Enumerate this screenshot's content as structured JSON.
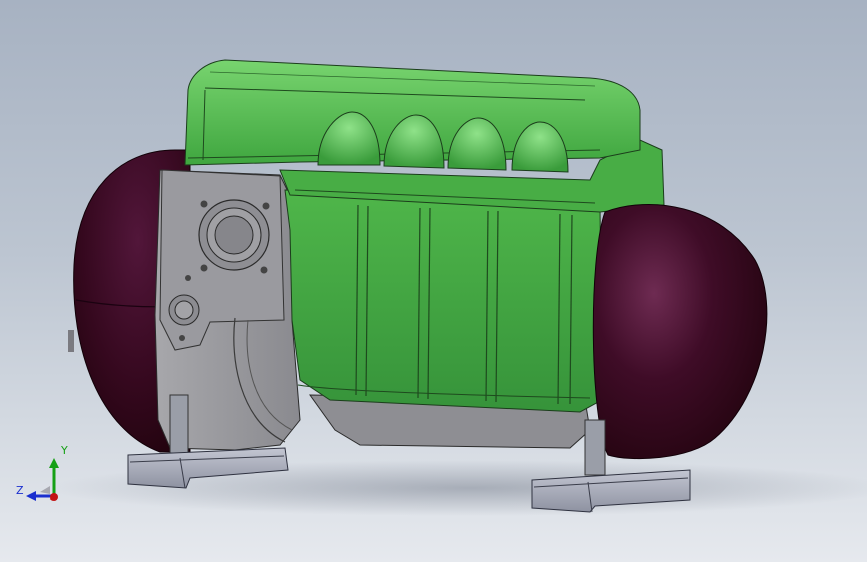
{
  "viewport": {
    "background_top": "#a7b2c2",
    "background_bottom": "#e6e9ee"
  },
  "model": {
    "colors": {
      "block_green": "#3fa63f",
      "block_green_light": "#6fcf6a",
      "block_green_dark": "#2c7f2f",
      "tank_maroon": "#3a0a22",
      "tank_highlight": "#6e2b52",
      "housing_gray": "#8e8e93",
      "housing_light": "#b4b4b8",
      "bracket_gray": "#a9adbb",
      "edge_line": "#1a1a1a"
    }
  },
  "triad": {
    "x_label": "",
    "y_label": "Y",
    "z_label": "Z",
    "colors": {
      "x_axis": "#d11919",
      "y_axis": "#15a015",
      "z_axis": "#1a2fcf"
    }
  }
}
